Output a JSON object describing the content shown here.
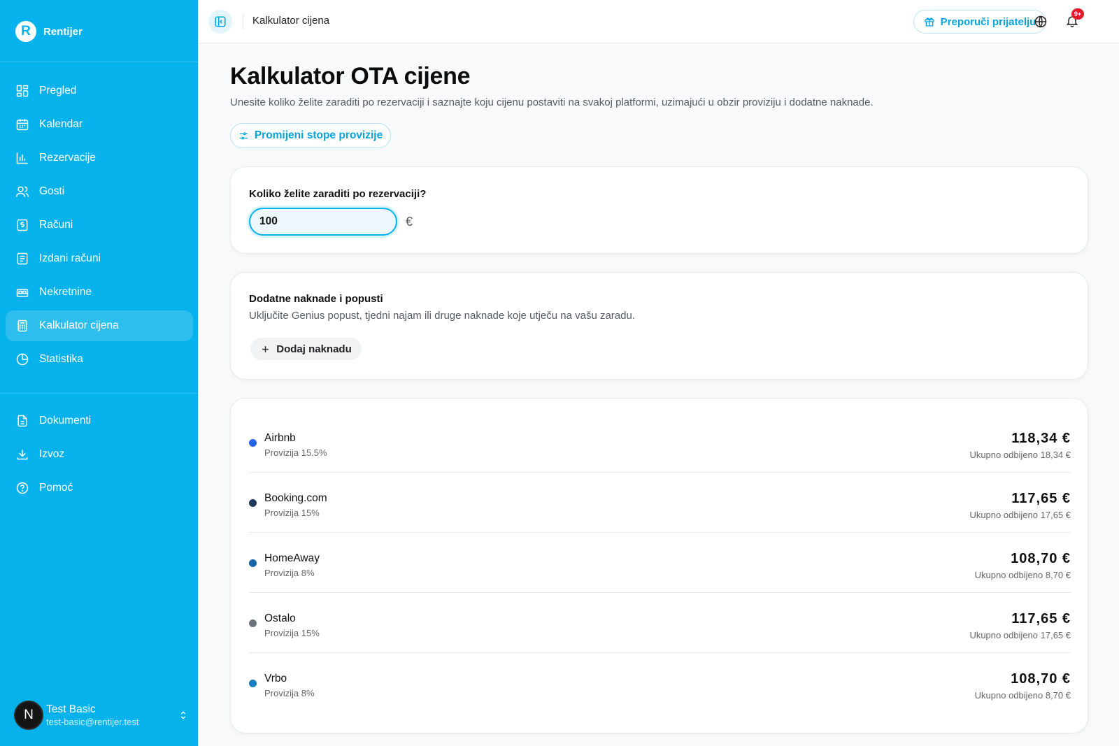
{
  "brand": {
    "name": "Rentijer",
    "logo_letter": "R"
  },
  "sidebar": {
    "items": [
      {
        "label": "Pregled",
        "icon": "grid-icon",
        "active": false
      },
      {
        "label": "Kalendar",
        "icon": "calendar-icon",
        "active": false
      },
      {
        "label": "Rezervacije",
        "icon": "bar-chart-icon",
        "active": false
      },
      {
        "label": "Gosti",
        "icon": "users-icon",
        "active": false
      },
      {
        "label": "Računi",
        "icon": "invoice-icon",
        "active": false
      },
      {
        "label": "Izdani računi",
        "icon": "receipt-icon",
        "active": false
      },
      {
        "label": "Nekretnine",
        "icon": "bed-icon",
        "active": false
      },
      {
        "label": "Kalkulator cijena",
        "icon": "calculator-icon",
        "active": true
      },
      {
        "label": "Statistika",
        "icon": "pie-chart-icon",
        "active": false
      },
      {
        "label": "Dokumenti",
        "icon": "document-icon",
        "active": false
      },
      {
        "label": "Izvoz",
        "icon": "download-icon",
        "active": false
      },
      {
        "label": "Pomoć",
        "icon": "help-icon",
        "active": false
      }
    ],
    "user": {
      "avatar_letter": "N",
      "name": "Test Basic",
      "email": "test-basic@rentijer.test"
    }
  },
  "topbar": {
    "title": "Kalkulator cijena",
    "refer_label": "Preporuči prijatelju",
    "notification_badge": "9+"
  },
  "main": {
    "title": "Kalkulator OTA cijene",
    "description": "Unesite koliko želite zaraditi po rezervaciji i saznajte koju cijenu postaviti na svakoj platformi, uzimajući u obzir proviziju i dodatne naknade.",
    "rates_button": "Promijeni stope provizije",
    "earnings": {
      "label": "Koliko želite zaraditi po rezervaciji?",
      "value": "100",
      "currency": "€"
    },
    "fees": {
      "title": "Dodatne naknade i popusti",
      "subtitle": "Uključite Genius popust, tjedni najam ili druge naknade koje utječu na vašu zaradu.",
      "add_label": "Dodaj naknadu"
    },
    "platforms": [
      {
        "name": "Airbnb",
        "commission": "Provizija 15.5%",
        "price": "118,34 €",
        "deducted": "Ukupno odbijeno 18,34 €",
        "color": "#2563eb"
      },
      {
        "name": "Booking.com",
        "commission": "Provizija 15%",
        "price": "117,65 €",
        "deducted": "Ukupno odbijeno 17,65 €",
        "color": "#1e3a5f"
      },
      {
        "name": "HomeAway",
        "commission": "Provizija 8%",
        "price": "108,70 €",
        "deducted": "Ukupno odbijeno 8,70 €",
        "color": "#1565a8"
      },
      {
        "name": "Ostalo",
        "commission": "Provizija 15%",
        "price": "117,65 €",
        "deducted": "Ukupno odbijeno 17,65 €",
        "color": "#6b7280"
      },
      {
        "name": "Vrbo",
        "commission": "Provizija 8%",
        "price": "108,70 €",
        "deducted": "Ukupno odbijeno 8,70 €",
        "color": "#1a7fc1"
      }
    ]
  },
  "colors": {
    "sidebar": "#05b2eb",
    "accent": "#05a4dc",
    "badge": "#e31c2d"
  }
}
